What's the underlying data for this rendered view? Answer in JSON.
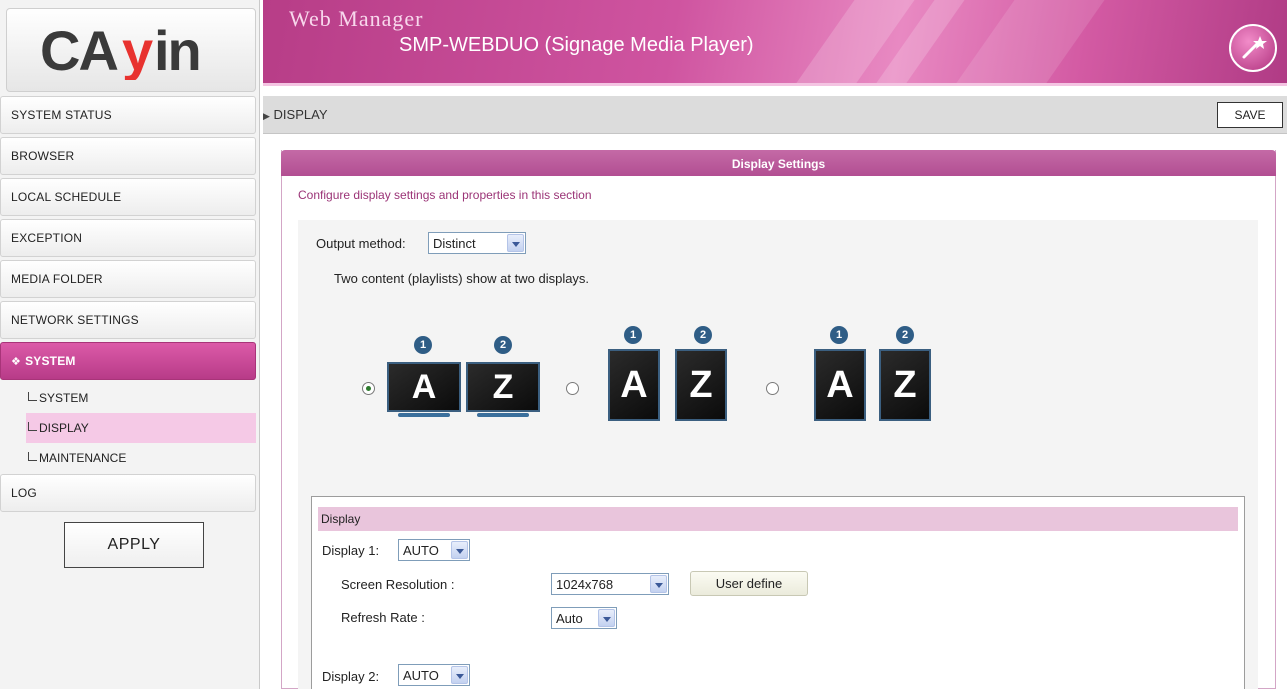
{
  "sidebar": {
    "items": [
      {
        "label": "SYSTEM STATUS"
      },
      {
        "label": "BROWSER"
      },
      {
        "label": "LOCAL SCHEDULE"
      },
      {
        "label": "EXCEPTION"
      },
      {
        "label": "MEDIA FOLDER"
      },
      {
        "label": "NETWORK SETTINGS"
      },
      {
        "label": "SYSTEM"
      },
      {
        "label": "LOG"
      }
    ],
    "subitems": [
      {
        "label": "SYSTEM"
      },
      {
        "label": "DISPLAY"
      },
      {
        "label": "MAINTENANCE"
      }
    ],
    "apply_label": "APPLY"
  },
  "header": {
    "logo_text": "CAYIN",
    "title": "Web Manager",
    "subtitle": "SMP-WEBDUO (Signage Media Player)"
  },
  "breadcrumb": {
    "label": "DISPLAY",
    "save_label": "SAVE"
  },
  "panel": {
    "title": "Display Settings",
    "description": "Configure display settings and properties in this section",
    "output_method_label": "Output method:",
    "output_method_value": "Distinct",
    "output_hint": "Two content (playlists) show at two displays.",
    "layouts": [
      {
        "selected": true,
        "screens": [
          "A",
          "Z"
        ],
        "badges": [
          "1",
          "2"
        ]
      },
      {
        "selected": false,
        "screens": [
          "A",
          "Z"
        ],
        "badges": [
          "1",
          "2"
        ]
      },
      {
        "selected": false,
        "screens": [
          "A",
          "Z"
        ],
        "badges": [
          "1",
          "2"
        ]
      }
    ]
  },
  "display_section": {
    "heading": "Display",
    "display1_label": "Display 1:",
    "display1_value": "AUTO",
    "resolution_label": "Screen Resolution :",
    "resolution_value": "1024x768",
    "user_define_label": "User define",
    "refresh_label": "Refresh Rate :",
    "refresh_value": "Auto",
    "display2_label": "Display 2:",
    "display2_value": "AUTO"
  },
  "colors": {
    "accent": "#c14f98",
    "active_sub": "#f5c9e6",
    "panel_head": "#b85296",
    "badge": "#2f5d86"
  }
}
